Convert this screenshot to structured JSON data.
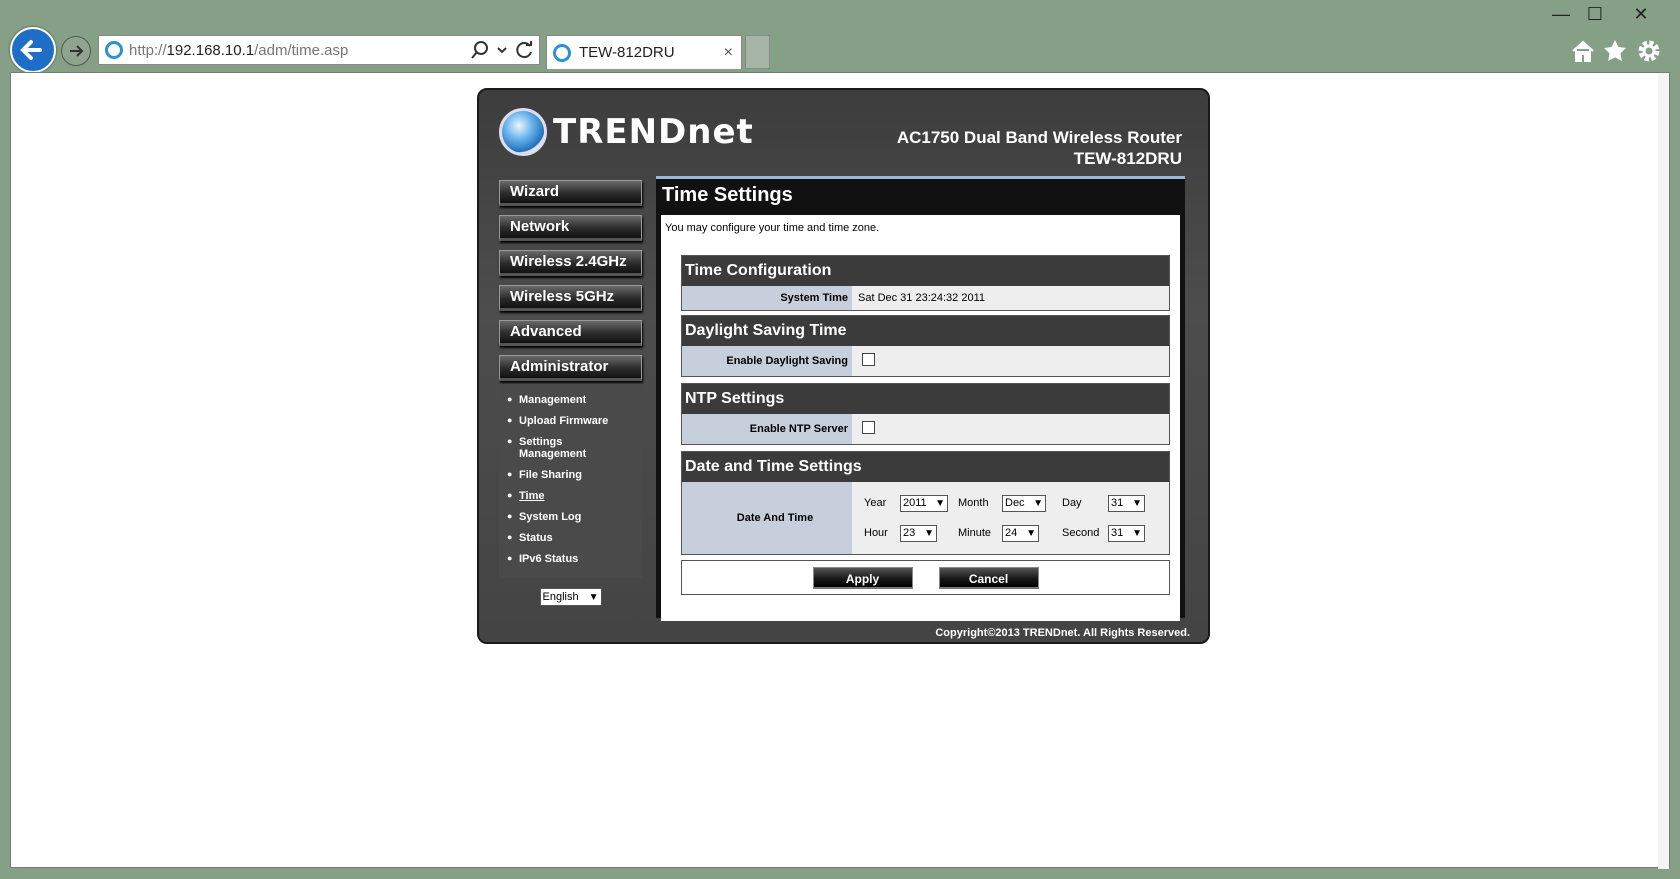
{
  "browser": {
    "address_prefix": "http://",
    "address_host": "192.168.10.1",
    "address_path": "/adm/time.asp",
    "tab_title": "TEW-812DRU",
    "tab_close": "×",
    "minimize": "—",
    "maximize": "☐",
    "close": "✕"
  },
  "header": {
    "brand": "TRENDnet",
    "model_line1": "AC1750 Dual Band Wireless Router",
    "model_line2": "TEW-812DRU"
  },
  "nav": {
    "wizard": "Wizard",
    "network": "Network",
    "wireless24": "Wireless 2.4GHz",
    "wireless5": "Wireless 5GHz",
    "advanced": "Advanced",
    "administrator": "Administrator",
    "sub": [
      "Management",
      "Upload Firmware",
      "Settings Management",
      "File Sharing",
      "Time",
      "System Log",
      "Status",
      "IPv6 Status"
    ],
    "language": "English"
  },
  "page": {
    "title": "Time Settings",
    "description": "You may configure your time and time zone."
  },
  "time_config": {
    "heading": "Time Configuration",
    "system_time_label": "System Time",
    "system_time_value": "Sat Dec 31 23:24:32 2011"
  },
  "daylight": {
    "heading": "Daylight Saving Time",
    "enable_label": "Enable Daylight Saving",
    "enabled": false
  },
  "ntp": {
    "heading": "NTP Settings",
    "enable_label": "Enable NTP Server",
    "enabled": false
  },
  "datetime": {
    "heading": "Date and Time Settings",
    "label": "Date And Time",
    "year_label": "Year",
    "year": "2011",
    "month_label": "Month",
    "month": "Dec",
    "day_label": "Day",
    "day": "31",
    "hour_label": "Hour",
    "hour": "23",
    "minute_label": "Minute",
    "minute": "24",
    "second_label": "Second",
    "second": "31"
  },
  "actions": {
    "apply": "Apply",
    "cancel": "Cancel"
  },
  "footer": {
    "copyright": "Copyright©2013 TRENDnet. All Rights Reserved."
  },
  "colors": {
    "chrome": "#86a088",
    "panel": "#444444",
    "accent_bar": "#9bb6d8",
    "label_bg": "#c8cfdc"
  }
}
